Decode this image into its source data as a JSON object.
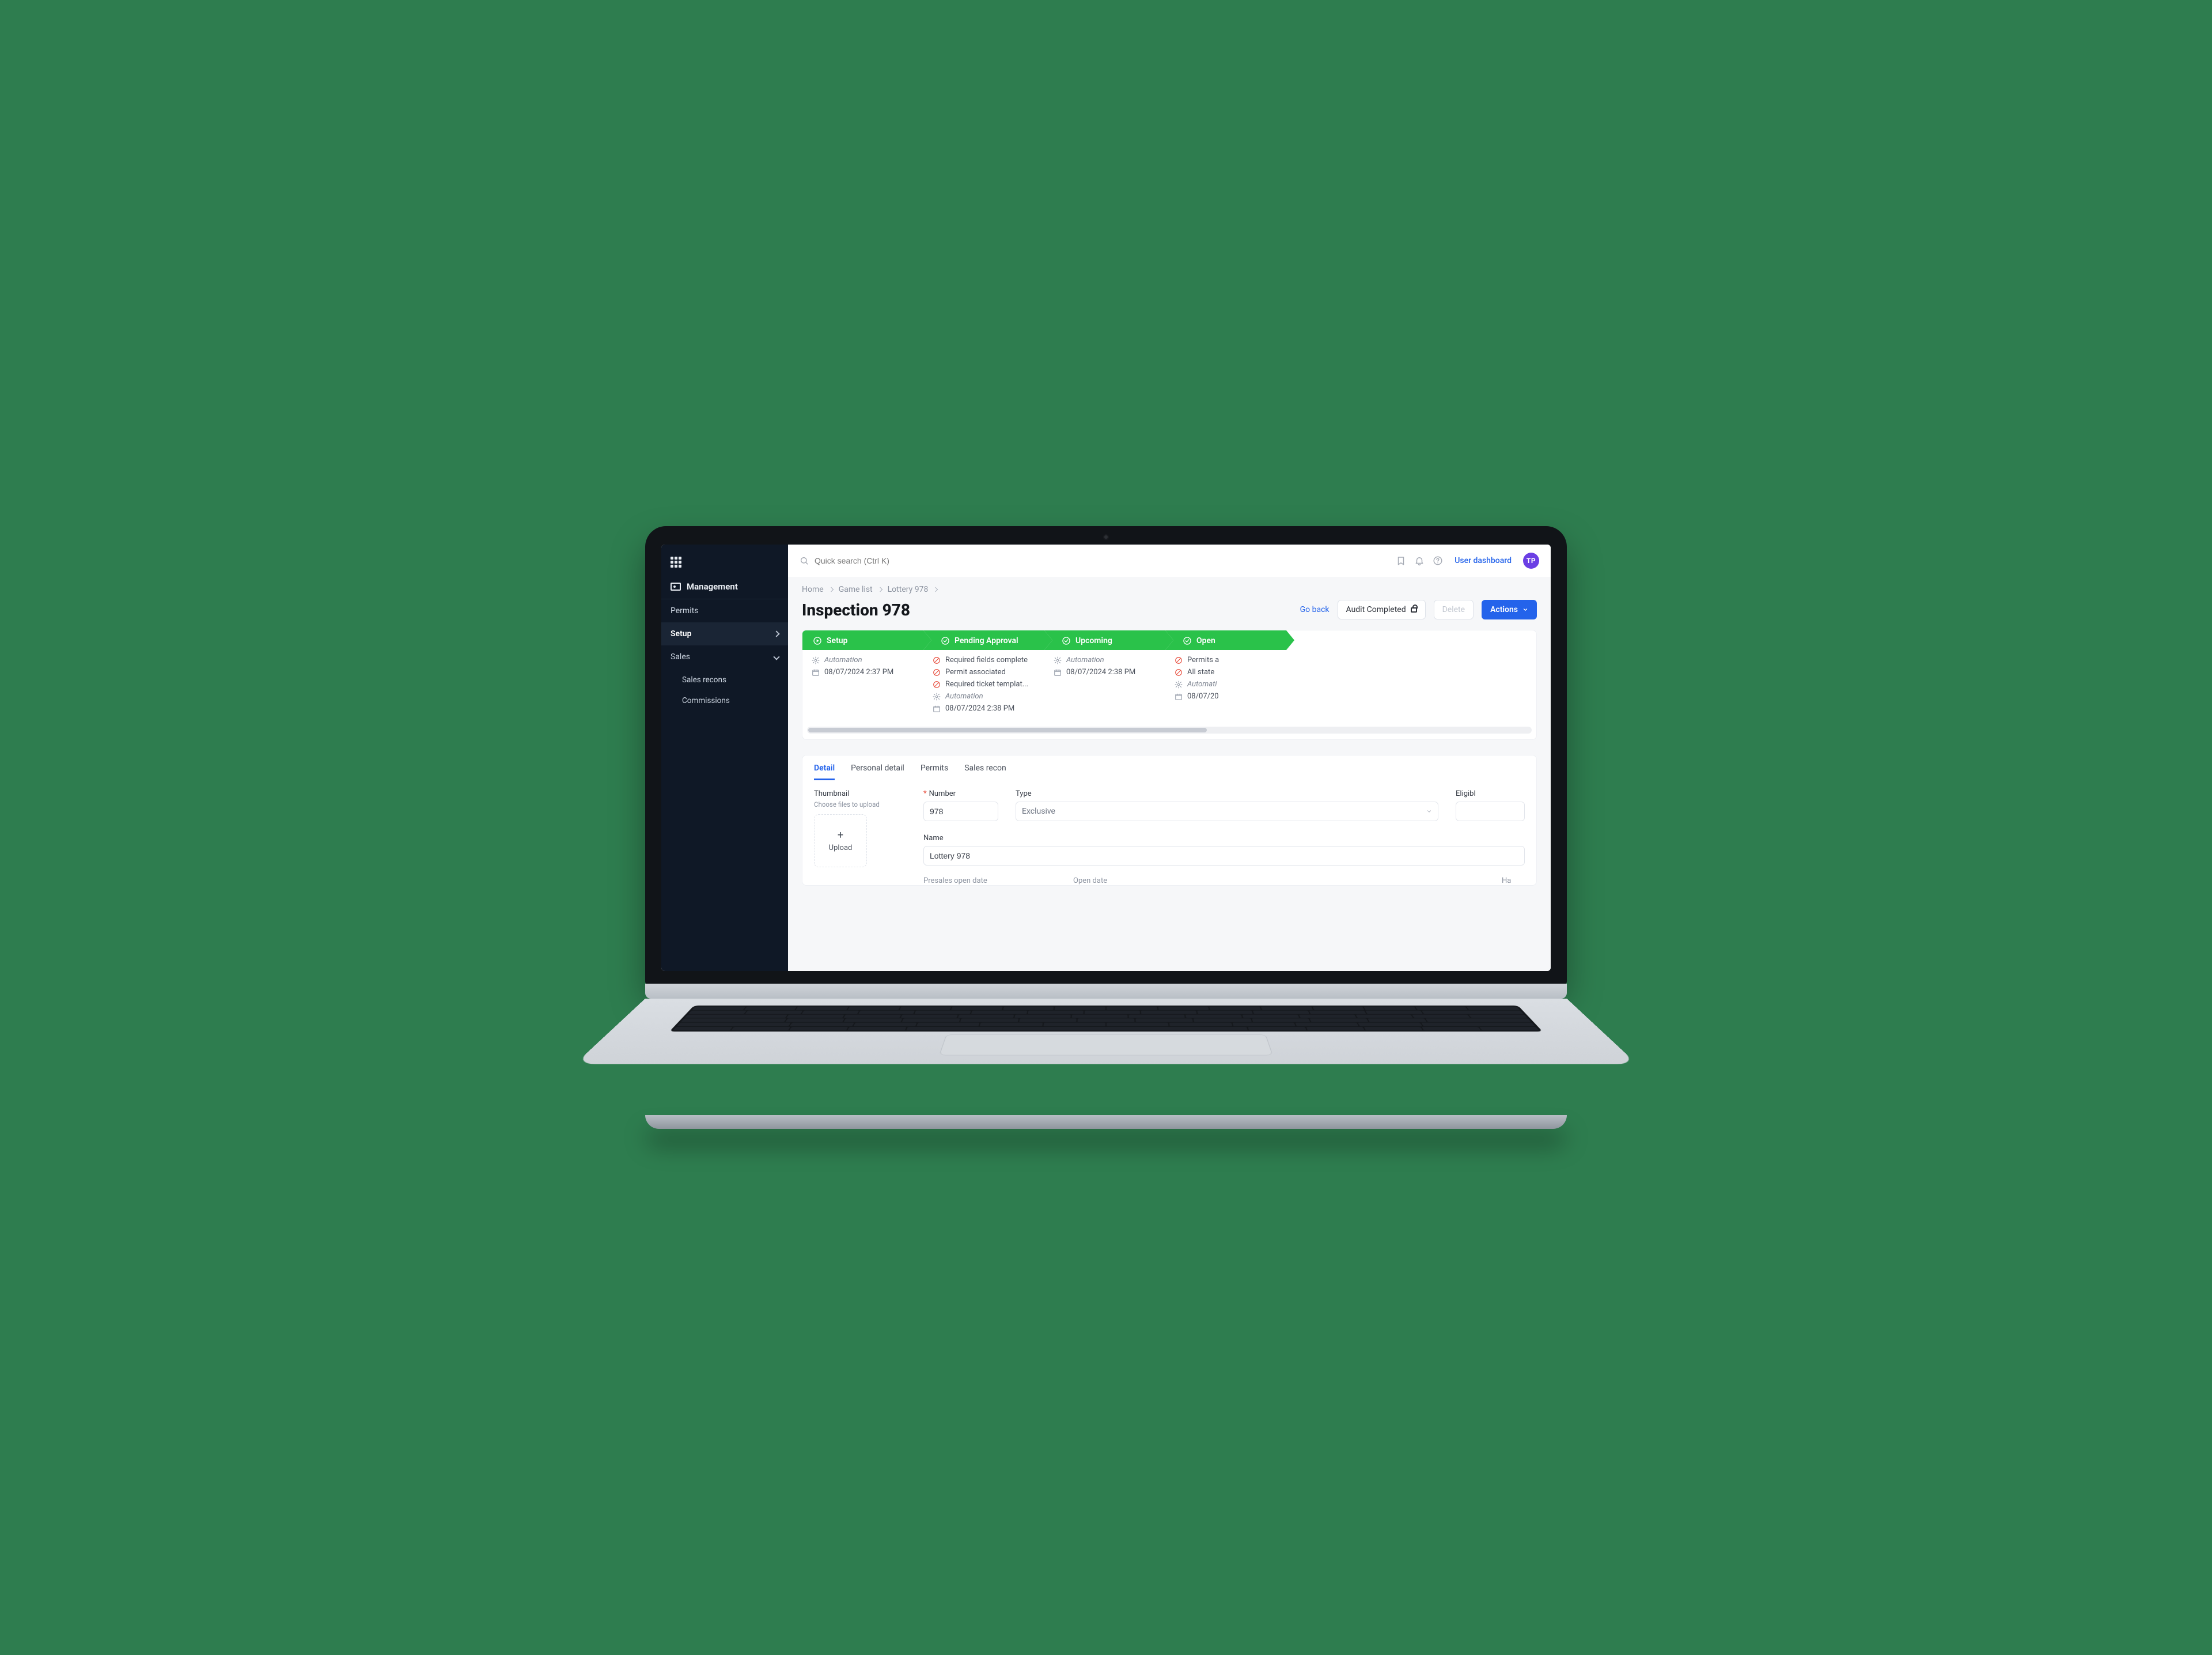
{
  "topbar": {
    "search_placeholder": "Quick search (Ctrl K)",
    "user_link": "User dashboard",
    "avatar_initials": "TP"
  },
  "sidebar": {
    "section_title": "Management",
    "items": [
      {
        "label": "Permits",
        "active": false
      },
      {
        "label": "Setup",
        "active": true
      },
      {
        "label": "Sales",
        "active": false
      }
    ],
    "sales_children": [
      {
        "label": "Sales recons"
      },
      {
        "label": "Commissions"
      }
    ]
  },
  "breadcrumb": {
    "items": [
      "Home",
      "Game list",
      "Lottery 978"
    ]
  },
  "page": {
    "title": "Inspection 978",
    "go_back": "Go back",
    "audit_btn": "Audit Completed",
    "delete_btn": "Delete",
    "actions_btn": "Actions"
  },
  "workflow": {
    "stages": [
      {
        "name": "Setup",
        "items": [
          {
            "type": "auto",
            "text": "Automation"
          },
          {
            "type": "date",
            "text": "08/07/2024 2:37 PM"
          }
        ]
      },
      {
        "name": "Pending Approval",
        "items": [
          {
            "type": "block",
            "text": "Required fields complete"
          },
          {
            "type": "block",
            "text": "Permit associated"
          },
          {
            "type": "block",
            "text": "Required ticket templat..."
          },
          {
            "type": "auto",
            "text": "Automation"
          },
          {
            "type": "date",
            "text": "08/07/2024 2:38 PM"
          }
        ]
      },
      {
        "name": "Upcoming",
        "items": [
          {
            "type": "auto",
            "text": "Automation"
          },
          {
            "type": "date",
            "text": "08/07/2024 2:38 PM"
          }
        ]
      },
      {
        "name": "Open",
        "items": [
          {
            "type": "block",
            "text": "Permits a"
          },
          {
            "type": "block",
            "text": "All state"
          },
          {
            "type": "auto",
            "text": "Automati"
          },
          {
            "type": "date",
            "text": "08/07/20"
          }
        ]
      }
    ]
  },
  "tabs": {
    "items": [
      "Detail",
      "Personal detail",
      "Permits",
      "Sales recon"
    ],
    "active": 0
  },
  "form": {
    "thumbnail_label": "Thumbnail",
    "thumbnail_hint": "Choose files to upload",
    "upload_label": "Upload",
    "number_label": "Number",
    "number_value": "978",
    "type_label": "Type",
    "type_value": "Exclusive",
    "eligible_label": "Eligibl",
    "name_label": "Name",
    "name_value": "Lottery 978",
    "presales_label": "Presales open date",
    "open_date_label": "Open date",
    "ha_label": "Ha"
  }
}
